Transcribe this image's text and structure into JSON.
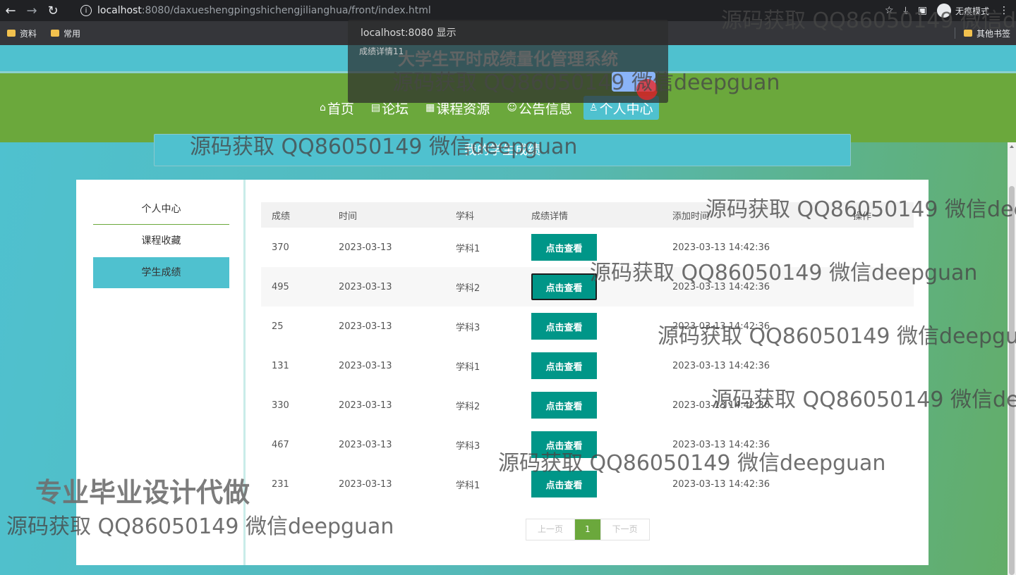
{
  "browser": {
    "url_host": "localhost",
    "url_path": ":8080/daxueshengpingshichengjilianghua/front/index.html",
    "profile_label": "无痕模式",
    "bookmarks": [
      "资料",
      "常用"
    ],
    "other_bookmarks": "其他书签"
  },
  "alert": {
    "title": "localhost:8080 显示",
    "message": "成绩详情11"
  },
  "site": {
    "title": "大学生平时成绩量化管理系统",
    "nav": [
      {
        "icon": "⌂",
        "label": "首页"
      },
      {
        "icon": "▤",
        "label": "论坛"
      },
      {
        "icon": "▦",
        "label": "课程资源"
      },
      {
        "icon": "☺",
        "label": "公告信息"
      },
      {
        "icon": "♙",
        "label": "个人中心"
      }
    ],
    "section_title": "我的学生成绩"
  },
  "sidebar": {
    "items": [
      "个人中心",
      "课程收藏",
      "学生成绩"
    ]
  },
  "table": {
    "headers": [
      "成绩",
      "时间",
      "学科",
      "成绩详情",
      "添加时间",
      "操作"
    ],
    "button_label": "点击查看",
    "rows": [
      {
        "score": "370",
        "date": "2023-03-13",
        "subject": "学科1",
        "added": "2023-03-13 14:42:36"
      },
      {
        "score": "495",
        "date": "2023-03-13",
        "subject": "学科2",
        "added": "2023-03-13 14:42:36"
      },
      {
        "score": "25",
        "date": "2023-03-13",
        "subject": "学科3",
        "added": "2023-03-13 14:42:36"
      },
      {
        "score": "131",
        "date": "2023-03-13",
        "subject": "学科1",
        "added": "2023-03-13 14:42:36"
      },
      {
        "score": "330",
        "date": "2023-03-13",
        "subject": "学科2",
        "added": "2023-03-13 14:42:36"
      },
      {
        "score": "467",
        "date": "2023-03-13",
        "subject": "学科3",
        "added": "2023-03-13 14:42:36"
      },
      {
        "score": "231",
        "date": "2023-03-13",
        "subject": "学科1",
        "added": "2023-03-13 14:42:36"
      }
    ]
  },
  "pager": {
    "prev": "上一页",
    "page": "1",
    "next": "下一页"
  },
  "watermark": {
    "text": "源码获取 QQ86050149 微信deepguan",
    "slogan": "专业毕业设计代做"
  }
}
